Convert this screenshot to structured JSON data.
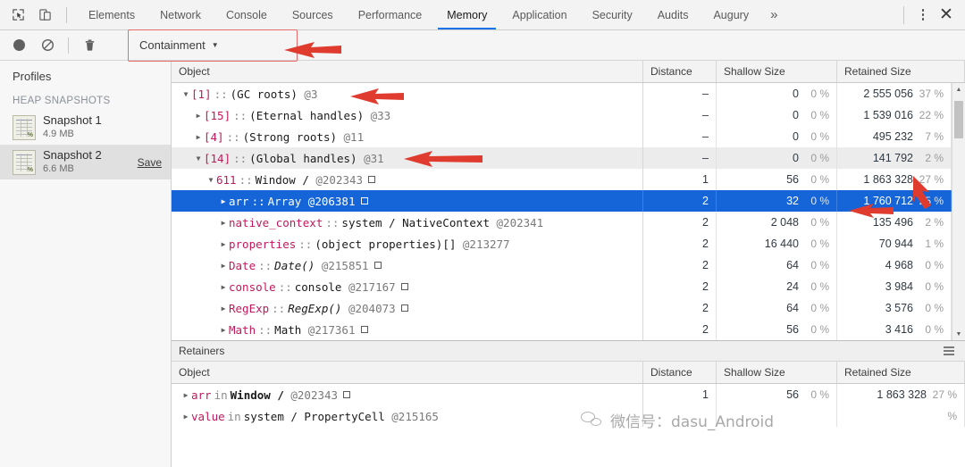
{
  "tabbar": {
    "icons": [
      {
        "name": "inspect-element-icon"
      },
      {
        "name": "device-toolbar-icon"
      }
    ],
    "tabs": [
      {
        "label": "Elements",
        "active": false
      },
      {
        "label": "Network",
        "active": false
      },
      {
        "label": "Console",
        "active": false
      },
      {
        "label": "Sources",
        "active": false
      },
      {
        "label": "Performance",
        "active": false
      },
      {
        "label": "Memory",
        "active": true
      },
      {
        "label": "Application",
        "active": false
      },
      {
        "label": "Security",
        "active": false
      },
      {
        "label": "Audits",
        "active": false
      },
      {
        "label": "Augury",
        "active": false
      }
    ],
    "more_label": "»",
    "close_label": "✕",
    "active_underline_color": "#1a73e8"
  },
  "toolbar": {
    "record_icon": "record-icon",
    "clear_icon": "ban-clear-icon",
    "delete_icon": "trash-icon",
    "view_select": {
      "label": "Containment",
      "caret": "▼",
      "highlight_color": "#e86a6a"
    }
  },
  "sidebar": {
    "title": "Profiles",
    "section_label": "HEAP SNAPSHOTS",
    "snapshots": [
      {
        "name": "Snapshot 1",
        "size": "4.9 MB",
        "selected": false,
        "save_label": ""
      },
      {
        "name": "Snapshot 2",
        "size": "6.6 MB",
        "selected": true,
        "save_label": "Save"
      }
    ]
  },
  "main": {
    "columns": [
      "Object",
      "Distance",
      "Shallow Size",
      "Retained Size"
    ],
    "rows": [
      {
        "indent": 0,
        "twisty": "▼",
        "index": "[1]",
        "sep": "::",
        "name": "(GC roots)",
        "id": "@3",
        "box": false,
        "italic": false,
        "bold": false,
        "distance": "–",
        "shallow": "0",
        "shallow_pct": "0 %",
        "retained": "2 555 056",
        "retained_pct": "37 %",
        "selected": false,
        "alt": false
      },
      {
        "indent": 1,
        "twisty": "▶",
        "index": "[15]",
        "sep": "::",
        "name": "(Eternal handles)",
        "id": "@33",
        "box": false,
        "italic": false,
        "bold": false,
        "distance": "–",
        "shallow": "0",
        "shallow_pct": "0 %",
        "retained": "1 539 016",
        "retained_pct": "22 %",
        "selected": false,
        "alt": false
      },
      {
        "indent": 1,
        "twisty": "▶",
        "index": "[4]",
        "sep": "::",
        "name": "(Strong roots)",
        "id": "@11",
        "box": false,
        "italic": false,
        "bold": false,
        "distance": "–",
        "shallow": "0",
        "shallow_pct": "0 %",
        "retained": "495 232",
        "retained_pct": "7 %",
        "selected": false,
        "alt": false
      },
      {
        "indent": 1,
        "twisty": "▼",
        "index": "[14]",
        "sep": "::",
        "name": "(Global handles)",
        "id": "@31",
        "box": false,
        "italic": false,
        "bold": false,
        "distance": "–",
        "shallow": "0",
        "shallow_pct": "0 %",
        "retained": "141 792",
        "retained_pct": "2 %",
        "selected": false,
        "alt": true
      },
      {
        "indent": 2,
        "twisty": "▼",
        "index": "611",
        "sep": "::",
        "name": "Window /",
        "id": "@202343",
        "box": true,
        "italic": false,
        "bold": false,
        "distance": "1",
        "shallow": "56",
        "shallow_pct": "0 %",
        "retained": "1 863 328",
        "retained_pct": "27 %",
        "selected": false,
        "alt": false
      },
      {
        "indent": 3,
        "twisty": "▶",
        "index": "arr",
        "sep": "::",
        "name": "Array",
        "id": "@206381",
        "box": true,
        "italic": false,
        "bold": false,
        "distance": "2",
        "shallow": "32",
        "shallow_pct": "0 %",
        "retained": "1 760 712",
        "retained_pct": "25 %",
        "selected": true,
        "alt": false
      },
      {
        "indent": 3,
        "twisty": "▶",
        "index": "native_context",
        "sep": "::",
        "name": "system / NativeContext",
        "id": "@202341",
        "box": false,
        "italic": false,
        "bold": false,
        "distance": "2",
        "shallow": "2 048",
        "shallow_pct": "0 %",
        "retained": "135 496",
        "retained_pct": "2 %",
        "selected": false,
        "alt": false
      },
      {
        "indent": 3,
        "twisty": "▶",
        "index": "properties",
        "sep": "::",
        "name": "(object properties)[]",
        "id": "@213277",
        "box": false,
        "italic": false,
        "bold": false,
        "distance": "2",
        "shallow": "16 440",
        "shallow_pct": "0 %",
        "retained": "70 944",
        "retained_pct": "1 %",
        "selected": false,
        "alt": false
      },
      {
        "indent": 3,
        "twisty": "▶",
        "index": "Date",
        "sep": "::",
        "name": "Date()",
        "id": "@215851",
        "box": true,
        "italic": true,
        "bold": false,
        "distance": "2",
        "shallow": "64",
        "shallow_pct": "0 %",
        "retained": "4 968",
        "retained_pct": "0 %",
        "selected": false,
        "alt": false
      },
      {
        "indent": 3,
        "twisty": "▶",
        "index": "console",
        "sep": "::",
        "name": "console",
        "id": "@217167",
        "box": true,
        "italic": false,
        "bold": false,
        "distance": "2",
        "shallow": "24",
        "shallow_pct": "0 %",
        "retained": "3 984",
        "retained_pct": "0 %",
        "selected": false,
        "alt": false
      },
      {
        "indent": 3,
        "twisty": "▶",
        "index": "RegExp",
        "sep": "::",
        "name": "RegExp()",
        "id": "@204073",
        "box": true,
        "italic": true,
        "bold": false,
        "distance": "2",
        "shallow": "64",
        "shallow_pct": "0 %",
        "retained": "3 576",
        "retained_pct": "0 %",
        "selected": false,
        "alt": false
      },
      {
        "indent": 3,
        "twisty": "▶",
        "index": "Math",
        "sep": "::",
        "name": "Math",
        "id": "@217361",
        "box": true,
        "italic": false,
        "bold": false,
        "distance": "2",
        "shallow": "56",
        "shallow_pct": "0 %",
        "retained": "3 416",
        "retained_pct": "0 %",
        "selected": false,
        "alt": false
      }
    ]
  },
  "retainers": {
    "title": "Retainers",
    "columns": [
      "Object",
      "Distance",
      "Shallow Size",
      "Retained Size"
    ],
    "rows": [
      {
        "indent": 0,
        "twisty": "▶",
        "index": "arr",
        "sep": "in",
        "name": "Window /",
        "id": "@202343",
        "box": true,
        "italic": false,
        "bold": true,
        "distance": "1",
        "shallow": "56",
        "shallow_pct": "0 %",
        "retained": "1 863 328",
        "retained_pct": "27 %"
      },
      {
        "indent": 0,
        "twisty": "▶",
        "index": "value",
        "sep": "in",
        "name": "system / PropertyCell",
        "id": "@215165",
        "box": false,
        "italic": false,
        "bold": false,
        "distance": "",
        "shallow": "",
        "shallow_pct": "",
        "retained": "",
        "retained_pct": "%"
      }
    ]
  },
  "scrollbar": {
    "up_arrow": "▲",
    "down_arrow": "▼"
  },
  "watermark": {
    "text": "微信号：dasu_Android",
    "icon": "wechat-icon"
  },
  "annotations": {
    "arrow_color": "#e03b2f",
    "arrows": [
      {
        "name": "arrow-containment"
      },
      {
        "name": "arrow-gc-roots"
      },
      {
        "name": "arrow-global-handles"
      },
      {
        "name": "arrow-retained-pct-window"
      },
      {
        "name": "arrow-retained-pct-arr"
      }
    ]
  }
}
